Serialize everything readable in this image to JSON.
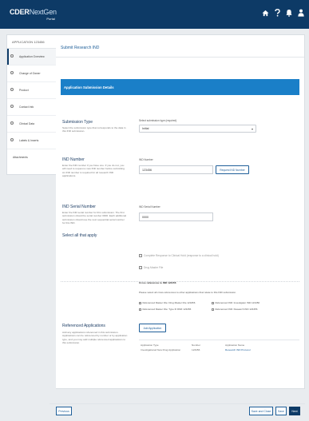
{
  "header": {
    "brand_main": "CDER",
    "brand_light": "NextGen",
    "brand_sub": "Portal",
    "icons": [
      "home-icon",
      "help-icon",
      "notifications-icon",
      "user-icon"
    ]
  },
  "sidebar": {
    "heading": "APPLICATION 123456",
    "items": [
      {
        "label": "Application Overview",
        "active": true
      },
      {
        "label": "Change of Owner"
      },
      {
        "label": "Product"
      },
      {
        "label": "Contact Info"
      },
      {
        "label": "Clinical Data"
      },
      {
        "label": "Labels & Inserts"
      },
      {
        "label": "Attachments"
      }
    ]
  },
  "main": {
    "title": "Submit Research IND",
    "banner": "Application Submission Details",
    "submission_type": {
      "title": "Submission Type",
      "desc": "Select the submission type that corresponds to the data in this IND submission.",
      "field_label": "Select submission type (required)",
      "value": "Initial"
    },
    "ind_number": {
      "title": "IND Number",
      "desc": "Enter the IND number if you have one. If you do not, you will need to request a new IND number before submitting. An IND number is required for all research IND applications.",
      "field_label": "IND Number",
      "value": "123456",
      "button": "Request IND Number"
    },
    "ind_serial": {
      "title": "IND Serial Number",
      "desc": "Enter the IND serial number for this submission. The first submission should be serial number 0000. Each additional submission should use the next sequential serial number for this IND.",
      "field_label": "IND Serial Number",
      "value": "0000"
    },
    "applies": {
      "title": "Select all that apply",
      "check1": "Complete Response to Clinical Hold (response to a clinical hold)",
      "check2": "Drug Master File",
      "info_title": "Cross references to IND 123456",
      "info_desc": "Please select all cross-references to other applications that relate to this IND submission.",
      "refs": [
        "Referenced Master File: Drug Master File 123456",
        "Referenced IND: Investigator IND 123456",
        "Referenced Master File: Type III DMF 123456",
        "Referenced IND: Research IND 123456"
      ]
    },
    "referenced": {
      "title": "Referenced Applications",
      "desc": "Add any applications referenced in this submission. Applications can be referenced by number or by application type, and you may add multiple referenced applications to this submission.",
      "button": "Add Application",
      "columns": [
        "Application Type",
        "Number",
        "Application Name"
      ],
      "row": [
        "Investigational New Drug Application",
        "123456",
        "Research IND Protocol"
      ]
    }
  },
  "footer": {
    "previous": "Previous",
    "save_close": "Save and Close",
    "save": "Save",
    "next": "Next"
  },
  "colors": {
    "header_navy": "#0d3a66",
    "banner_blue": "#1a7fc8",
    "link_blue": "#1f5f99"
  }
}
